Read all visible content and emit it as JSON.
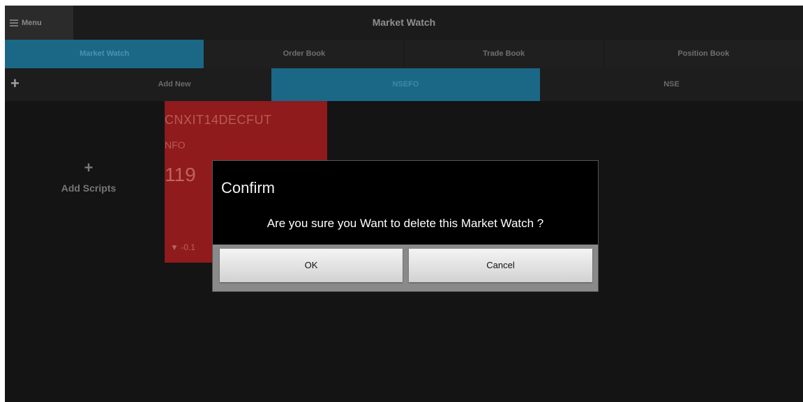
{
  "actionbar": {
    "menu_label": "Menu",
    "title": "Market Watch"
  },
  "tabs": [
    {
      "label": "Market Watch",
      "active": true
    },
    {
      "label": "Order Book",
      "active": false
    },
    {
      "label": "Trade Book",
      "active": false
    },
    {
      "label": "Position Book",
      "active": false
    }
  ],
  "subbar": {
    "add_new_label": "Add New",
    "segments": [
      {
        "label": "NSEFO",
        "active": true
      },
      {
        "label": "NSE",
        "active": false
      }
    ]
  },
  "add_scripts": {
    "icon": "+",
    "label": "Add Scripts"
  },
  "card": {
    "symbol": "CNXIT14DECFUT",
    "exchange": "NFO",
    "ltp_partial": "119",
    "change_partial": "▼ -0.1"
  },
  "dialog": {
    "title": "Confirm",
    "message": "Are you sure you Want to delete this Market Watch ?",
    "ok_label": "OK",
    "cancel_label": "Cancel"
  },
  "colors": {
    "accent": "#1a6886",
    "card_red": "#8f1b1c",
    "background": "#141414"
  }
}
